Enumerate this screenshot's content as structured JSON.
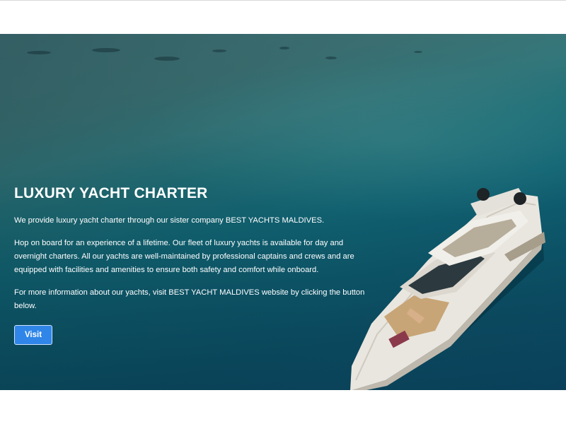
{
  "hero": {
    "title": "LUXURY YACHT CHARTER",
    "paragraphs": [
      "We provide luxury yacht charter through our sister company BEST YACHTS MALDIVES.",
      "Hop on board for an experience of a lifetime. Our fleet of luxury yachts is available for day and overnight charters. All our yachts are well-maintained by professional captains and crews and are equipped with facilities and amenities to ensure both safety and comfort while onboard.",
      "For more information about our yachts, visit BEST YACHT MALDIVES website by clicking the button below."
    ],
    "button_label": "Visit",
    "background_image": "luxury yacht on turquoise sea, aerial view"
  },
  "colors": {
    "button": "#2f86e8",
    "text": "#ffffff",
    "page_background": "#ffffff"
  }
}
